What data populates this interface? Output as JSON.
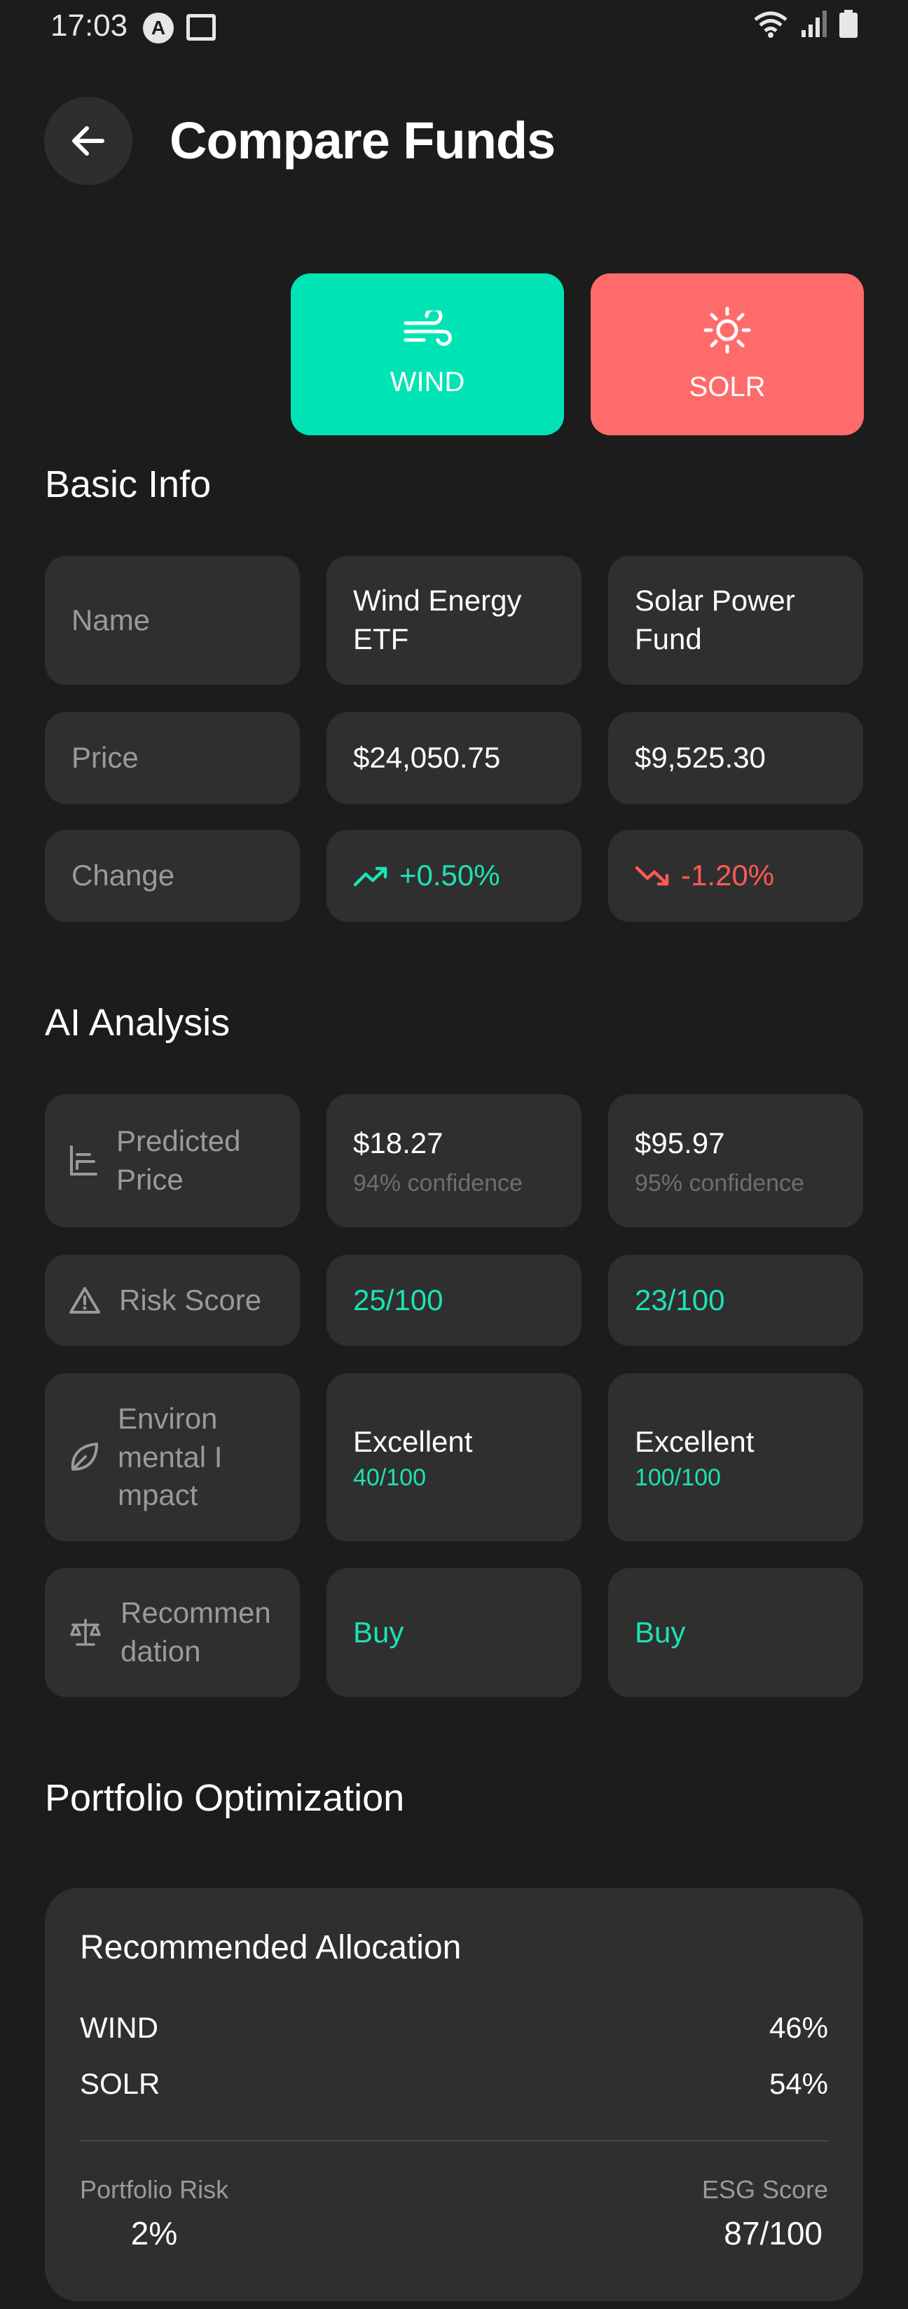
{
  "status_bar": {
    "time": "17:03",
    "auto_icon_letter": "A"
  },
  "header": {
    "title": "Compare Funds"
  },
  "funds": [
    {
      "ticker": "WIND",
      "icon": "wind-icon",
      "color": "#00e3b5"
    },
    {
      "ticker": "SOLR",
      "icon": "sun-icon",
      "color": "#ff6b6b"
    }
  ],
  "basic_info": {
    "title": "Basic Info",
    "rows": [
      {
        "label": "Name",
        "wind": "Wind Energy ETF",
        "solr": "Solar Power Fund"
      },
      {
        "label": "Price",
        "wind": "$24,050.75",
        "solr": "$9,525.30"
      },
      {
        "label": "Change",
        "wind": "+0.50%",
        "solr": "-1.20%"
      }
    ]
  },
  "ai_analysis": {
    "title": "AI Analysis",
    "predicted": {
      "label": "Predicted Price",
      "wind_value": "$18.27",
      "wind_sub": "94% confidence",
      "solr_value": "$95.97",
      "solr_sub": "95% confidence"
    },
    "risk": {
      "label": "Risk Score",
      "wind": "25/100",
      "solr": "23/100"
    },
    "environmental": {
      "label": "Environmental Impact",
      "wind_value": "Excellent",
      "wind_sub": "40/100",
      "solr_value": "Excellent",
      "solr_sub": "100/100"
    },
    "recommendation": {
      "label": "Recommendation",
      "wind": "Buy",
      "solr": "Buy"
    }
  },
  "portfolio": {
    "section_title": "Portfolio Optimization",
    "card_title": "Recommended Allocation",
    "allocations": [
      {
        "ticker": "WIND",
        "percent": "46%"
      },
      {
        "ticker": "SOLR",
        "percent": "54%"
      }
    ],
    "risk_label": "Portfolio Risk",
    "risk_value": "2%",
    "esg_label": "ESG Score",
    "esg_value": "87/100"
  }
}
